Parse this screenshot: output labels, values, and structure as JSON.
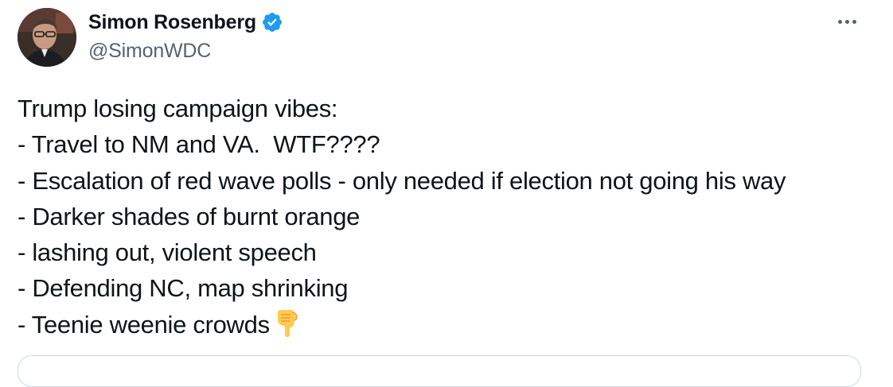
{
  "author": {
    "display_name": "Simon Rosenberg",
    "handle": "@SimonWDC",
    "verified": true,
    "avatar_icon": "profile-photo",
    "verified_icon": "verified-badge-icon"
  },
  "menu": {
    "icon": "more-options-icon"
  },
  "tweet": {
    "lines": [
      "Trump losing campaign vibes:",
      "- Travel to NM and VA.  WTF????",
      "- Escalation of red wave polls - only needed if election not going his way",
      "- Darker shades of burnt orange",
      "- lashing out, violent speech",
      "- Defending NC, map shrinking",
      "- Teenie weenie crowds"
    ],
    "trailing_emoji": "backhand-index-pointing-down"
  },
  "colors": {
    "text_primary": "#0f1419",
    "text_secondary": "#536471",
    "verified_blue": "#1d9bf0",
    "emoji_yellow": "#ffcc4d",
    "border": "#cfd9de"
  }
}
